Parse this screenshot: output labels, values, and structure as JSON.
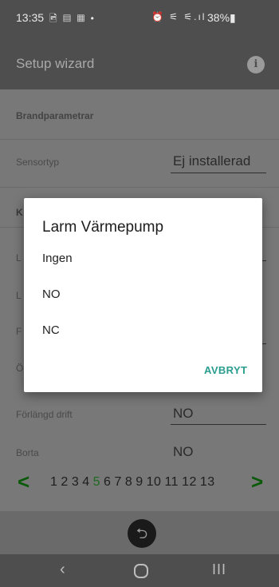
{
  "status_bar": {
    "time": "13:35",
    "left_icons": "🖻 ▤ ▦ •",
    "right_icons": "⏰ ⚟ ⚟.ıl",
    "battery": "38%▮"
  },
  "app_bar": {
    "title": "Setup wizard",
    "info_icon": "i"
  },
  "form": {
    "section_title": "Brandparametrar",
    "sensor_label": "Sensortyp",
    "sensor_value": "Ej installerad",
    "partial_section": "K",
    "partial_rows": [
      "L",
      "L",
      "F",
      "Ö"
    ],
    "extended_label": "Förlängd drift",
    "extended_value": "NO",
    "away_label": "Borta",
    "away_value": "NO"
  },
  "pager": {
    "prev": "<",
    "next": ">",
    "pages": [
      "1",
      "2",
      "3",
      "4",
      "5",
      "6",
      "7",
      "8",
      "9",
      "10",
      "11",
      "12",
      "13"
    ],
    "current": "5"
  },
  "undo_icon": "⮌",
  "nav": {
    "back": "‹",
    "recents": "III"
  },
  "dialog": {
    "title": "Larm Värmepump",
    "options": [
      "Ingen",
      "NO",
      "NC"
    ],
    "cancel_label": "AVBRYT"
  }
}
